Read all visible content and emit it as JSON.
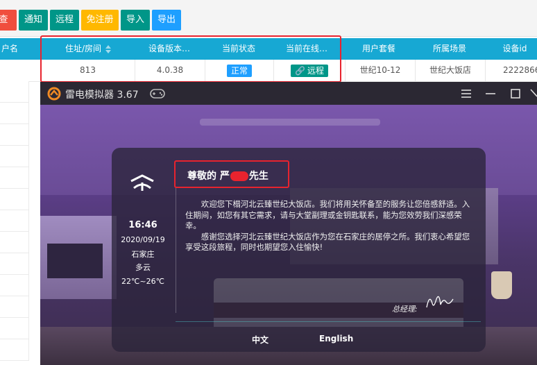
{
  "toolbar": {
    "cut_label": "查",
    "notify_label": "通知",
    "remote_label": "远程",
    "free_register_label": "免注册",
    "import_label": "导入",
    "export_label": "导出"
  },
  "table": {
    "cut_header": "户名",
    "headers": [
      "住址/房间",
      "设备版本…",
      "当前状态",
      "当前在线…",
      "用户套餐",
      "所属场景",
      "设备id"
    ],
    "row": {
      "room": "813",
      "version": "4.0.38",
      "status": "正常",
      "online": "远程",
      "package": "世纪10-12",
      "scene": "世纪大饭店",
      "device_id": "2222866"
    }
  },
  "emulator": {
    "title": "雷电模拟器 3.67",
    "time": "16:46",
    "date": "2020/09/19",
    "city": "石家庄",
    "weather": "多云",
    "temp": "22℃~26℃",
    "greeting_prefix": "尊敬的 严",
    "greeting_suffix": "先生",
    "paragraph1": "欢迎您下榻河北云臻世纪大饭店。我们将用关怀备至的服务让您倍感舒适。入住期间，如您有其它需求，请与大堂副理或金钥匙联系，能为您效劳我们深感荣幸。",
    "paragraph2": "感谢您选择河北云臻世纪大饭店作为您在石家庄的居停之所。我们衷心希望您享受这段旅程，同时也期望您入住愉快!",
    "signature_label": "总经理:",
    "lang_zh": "中文",
    "lang_en": "English"
  },
  "colors": {
    "toolbar_red": "#f04e3e",
    "toolbar_teal": "#009688",
    "toolbar_orange": "#ffb800",
    "toolbar_blue": "#1e9fff",
    "header_bg": "#17a8d3",
    "highlight_red": "#e8232e"
  }
}
